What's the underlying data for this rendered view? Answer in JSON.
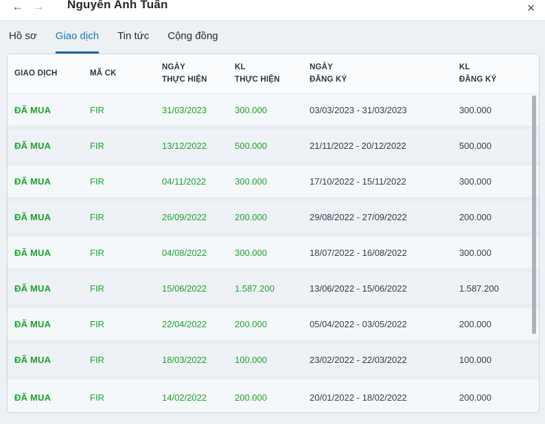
{
  "window": {
    "title": "Nguyễn Anh Tuấn",
    "close_glyph": "✕"
  },
  "nav": {
    "back_glyph": "←",
    "forward_glyph": "→"
  },
  "tabs": [
    {
      "id": "ho-so",
      "label": "Hồ sơ",
      "active": false
    },
    {
      "id": "giao-dich",
      "label": "Giao dịch",
      "active": true
    },
    {
      "id": "tin-tuc",
      "label": "Tin tức",
      "active": false
    },
    {
      "id": "cong-dong",
      "label": "Cộng đồng",
      "active": false
    }
  ],
  "table": {
    "columns": [
      {
        "line1": "GIAO DỊCH",
        "line2": ""
      },
      {
        "line1": "MÃ CK",
        "line2": ""
      },
      {
        "line1": "NGÀY",
        "line2": "THỰC HIỆN"
      },
      {
        "line1": "KL",
        "line2": "THỰC HIỆN"
      },
      {
        "line1": "NGÀY",
        "line2": "ĐĂNG KÝ"
      },
      {
        "line1": "KL",
        "line2": "ĐĂNG KÝ"
      }
    ],
    "rows": [
      {
        "status": "ĐÃ MUA",
        "code": "FIR",
        "exec_date": "31/03/2023",
        "exec_vol": "300.000",
        "reg_period": "03/03/2023 - 31/03/2023",
        "reg_vol": "300.000"
      },
      {
        "status": "ĐÃ MUA",
        "code": "FIR",
        "exec_date": "13/12/2022",
        "exec_vol": "500.000",
        "reg_period": "21/11/2022 - 20/12/2022",
        "reg_vol": "500.000"
      },
      {
        "status": "ĐÃ MUA",
        "code": "FIR",
        "exec_date": "04/11/2022",
        "exec_vol": "300.000",
        "reg_period": "17/10/2022 - 15/11/2022",
        "reg_vol": "300.000"
      },
      {
        "status": "ĐÃ MUA",
        "code": "FIR",
        "exec_date": "26/09/2022",
        "exec_vol": "200.000",
        "reg_period": "29/08/2022 - 27/09/2022",
        "reg_vol": "200.000"
      },
      {
        "status": "ĐÃ MUA",
        "code": "FIR",
        "exec_date": "04/08/2022",
        "exec_vol": "300.000",
        "reg_period": "18/07/2022 - 16/08/2022",
        "reg_vol": "300.000"
      },
      {
        "status": "ĐÃ MUA",
        "code": "FIR",
        "exec_date": "15/06/2022",
        "exec_vol": "1.587.200",
        "reg_period": "13/06/2022 - 15/06/2022",
        "reg_vol": "1.587.200"
      },
      {
        "status": "ĐÃ MUA",
        "code": "FIR",
        "exec_date": "22/04/2022",
        "exec_vol": "200.000",
        "reg_period": "05/04/2022 - 03/05/2022",
        "reg_vol": "200.000"
      },
      {
        "status": "ĐÃ MUA",
        "code": "FIR",
        "exec_date": "18/03/2022",
        "exec_vol": "100.000",
        "reg_period": "23/02/2022 - 22/03/2022",
        "reg_vol": "100.000"
      },
      {
        "status": "ĐÃ MUA",
        "code": "FIR",
        "exec_date": "14/02/2022",
        "exec_vol": "200.000",
        "reg_period": "20/01/2022 - 18/02/2022",
        "reg_vol": "200.000"
      }
    ]
  },
  "colors": {
    "accent_blue": "#1779b8",
    "positive_green": "#1aa32b",
    "dark_text": "#333c46",
    "page_background": "#edf1f4"
  }
}
